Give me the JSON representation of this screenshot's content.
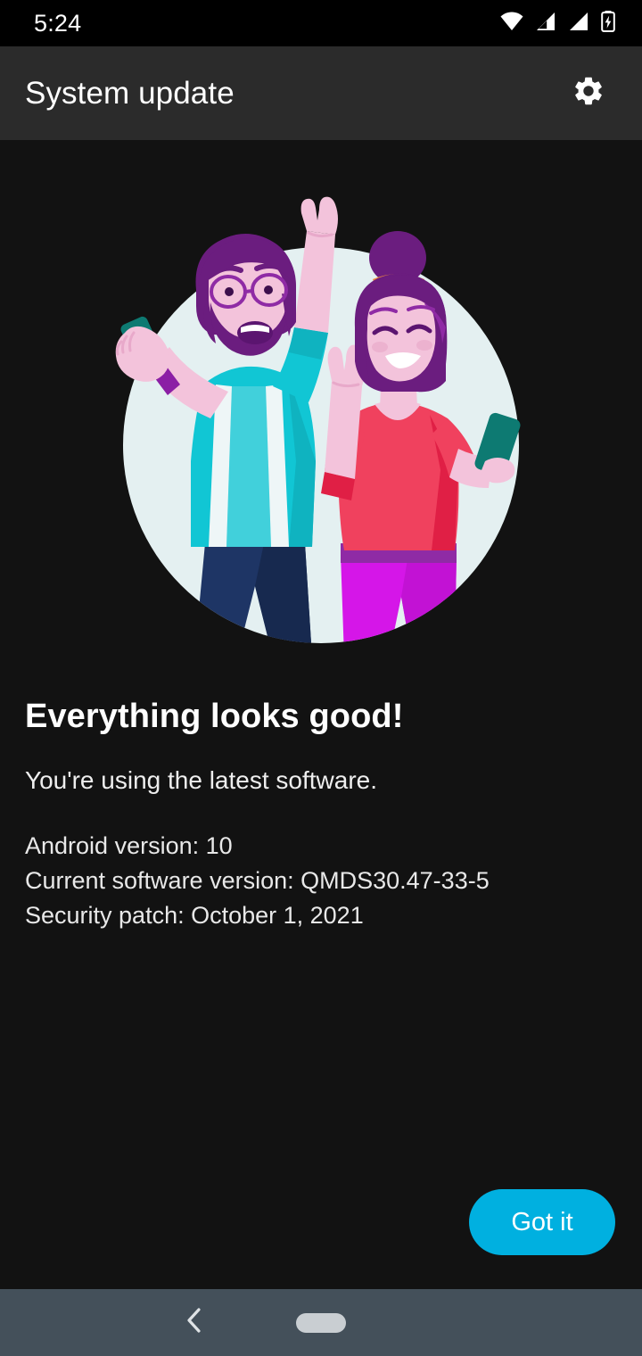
{
  "status_bar": {
    "clock": "5:24",
    "icons": [
      {
        "name": "wifi-icon",
        "label": "wifi"
      },
      {
        "name": "cellular-signal-1-icon",
        "label": "cellular signal 1"
      },
      {
        "name": "cellular-signal-2-icon",
        "label": "cellular signal 2"
      },
      {
        "name": "battery-charging-icon",
        "label": "battery charging"
      }
    ],
    "background_color": "#000000"
  },
  "app_bar": {
    "title": "System update",
    "settings_icon": "gear-icon",
    "background_color": "#2b2b2b"
  },
  "illustration": {
    "name": "people-celebrating-illustration",
    "circle_color": "#e4f0f1",
    "colors": {
      "skin": "#f3c3db",
      "skin_shadow": "#e8a9ca",
      "hair_purple": "#6b1d7f",
      "hair_purple_light": "#8f2ba5",
      "shirt_teal": "#11c6d4",
      "shirt_teal_dark": "#0fb3c0",
      "suspenders_white": "#eef6f7",
      "jeans_navy": "#1e3565",
      "jeans_navy_dark": "#17294f",
      "top_red": "#f0415e",
      "top_red_dark": "#e01f45",
      "pants_magenta": "#d516e8",
      "pants_magenta_dark": "#b410c4",
      "phone_teal": "#0d7a72",
      "hair_tie_orange": "#f08a3c",
      "wristband_purple": "#8b1fa5"
    }
  },
  "main": {
    "headline": "Everything looks good!",
    "subtitle": "You're using the latest software.",
    "details": [
      "Android version: 10",
      "Current software version: QMDS30.47-33-5",
      "Security patch: October 1, 2021"
    ],
    "background_color": "#121212"
  },
  "actions": {
    "got_it_label": "Got it",
    "got_it_color": "#00b0e0"
  },
  "nav_bar": {
    "background_color": "#44505a",
    "back_icon": "chevron-left-icon",
    "home_indicator": "home-pill-indicator"
  }
}
